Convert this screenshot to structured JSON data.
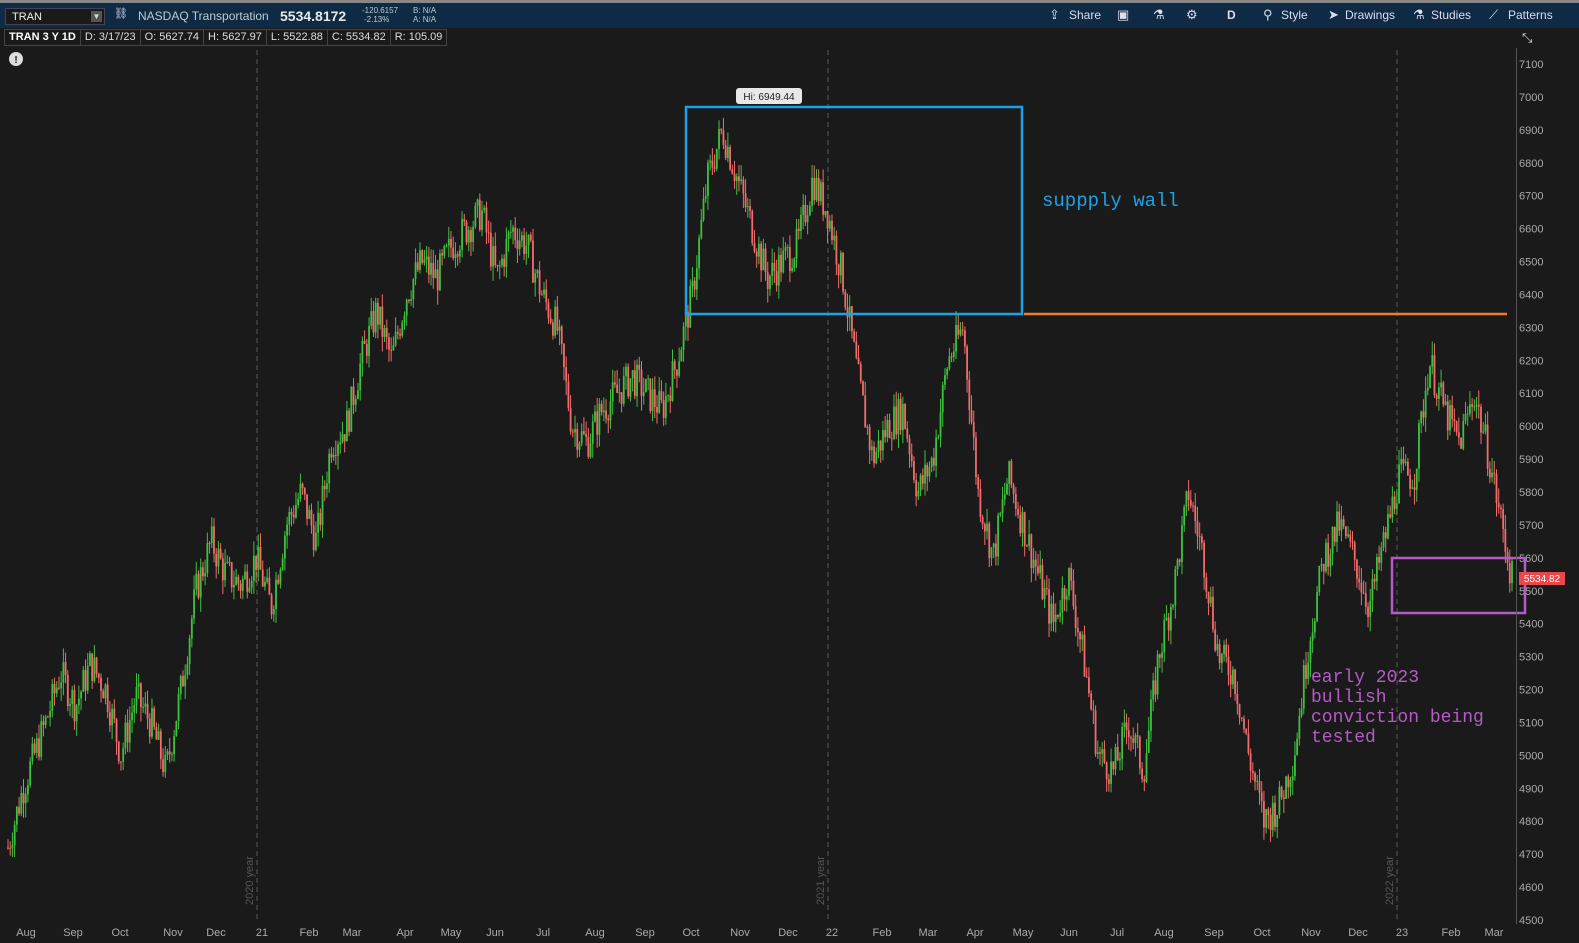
{
  "toolbar": {
    "symbol": "TRAN",
    "name": "NASDAQ Transportation",
    "price": "5534.8172",
    "change": "-120.6157",
    "change_pct": "-2.13%",
    "bid": "B: N/A",
    "ask": "A: N/A",
    "share": "Share",
    "period": "D",
    "style": "Style",
    "drawings": "Drawings",
    "studies": "Studies",
    "patterns": "Patterns"
  },
  "info": {
    "title": "TRAN 3 Y 1D",
    "date": "D: 3/17/23",
    "open": "O: 5627.74",
    "high": "H: 5627.97",
    "low": "L: 5522.88",
    "close": "C: 5534.82",
    "range": "R: 105.09"
  },
  "colors": {
    "up": "#3ec23e",
    "down": "#f36b6b",
    "blue_box": "#1ea0e6",
    "orange_line": "#f07c28",
    "purple": "#b65ac8"
  },
  "chart_data": {
    "type": "candlestick",
    "ylim": [
      4500,
      7150
    ],
    "yticks": [
      7100,
      7000,
      6900,
      6800,
      6700,
      6600,
      6500,
      6400,
      6300,
      6200,
      6100,
      6000,
      5900,
      5800,
      5700,
      5600,
      5500,
      5400,
      5300,
      5200,
      5100,
      5000,
      4900,
      4800,
      4700,
      4600,
      4500
    ],
    "x_labels": [
      "Aug",
      "Sep",
      "Oct",
      "Nov",
      "Dec",
      "21",
      "Feb",
      "Mar",
      "Apr",
      "May",
      "Jun",
      "Jul",
      "Aug",
      "Sep",
      "Oct",
      "Nov",
      "Dec",
      "22",
      "Feb",
      "Mar",
      "Apr",
      "May",
      "Jun",
      "Jul",
      "Aug",
      "Sep",
      "Oct",
      "Nov",
      "Dec",
      "23",
      "Feb",
      "Mar"
    ],
    "year_separators": [
      "2020 year",
      "2021 year",
      "2022 year"
    ],
    "last_price": "5534.82",
    "high_label": "Hi: 6949.44",
    "price_path": [
      [
        0,
        4720
      ],
      [
        0.01,
        4900
      ],
      [
        0.025,
        5100
      ],
      [
        0.035,
        5250
      ],
      [
        0.045,
        5150
      ],
      [
        0.055,
        5280
      ],
      [
        0.065,
        5200
      ],
      [
        0.075,
        5000
      ],
      [
        0.085,
        5180
      ],
      [
        0.095,
        5100
      ],
      [
        0.105,
        4950
      ],
      [
        0.115,
        5200
      ],
      [
        0.125,
        5500
      ],
      [
        0.135,
        5650
      ],
      [
        0.145,
        5550
      ],
      [
        0.155,
        5520
      ],
      [
        0.165,
        5600
      ],
      [
        0.175,
        5450
      ],
      [
        0.185,
        5700
      ],
      [
        0.195,
        5800
      ],
      [
        0.205,
        5650
      ],
      [
        0.215,
        5950
      ],
      [
        0.225,
        6000
      ],
      [
        0.235,
        6200
      ],
      [
        0.245,
        6350
      ],
      [
        0.255,
        6200
      ],
      [
        0.265,
        6400
      ],
      [
        0.275,
        6500
      ],
      [
        0.285,
        6450
      ],
      [
        0.295,
        6550
      ],
      [
        0.305,
        6600
      ],
      [
        0.315,
        6650
      ],
      [
        0.325,
        6450
      ],
      [
        0.335,
        6600
      ],
      [
        0.345,
        6550
      ],
      [
        0.355,
        6400
      ],
      [
        0.365,
        6300
      ],
      [
        0.375,
        6000
      ],
      [
        0.385,
        5950
      ],
      [
        0.395,
        6050
      ],
      [
        0.405,
        6100
      ],
      [
        0.415,
        6150
      ],
      [
        0.425,
        6100
      ],
      [
        0.435,
        6050
      ],
      [
        0.445,
        6200
      ],
      [
        0.455,
        6400
      ],
      [
        0.465,
        6750
      ],
      [
        0.475,
        6900
      ],
      [
        0.485,
        6750
      ],
      [
        0.495,
        6600
      ],
      [
        0.505,
        6450
      ],
      [
        0.515,
        6500
      ],
      [
        0.525,
        6550
      ],
      [
        0.535,
        6750
      ],
      [
        0.545,
        6650
      ],
      [
        0.555,
        6450
      ],
      [
        0.565,
        6150
      ],
      [
        0.575,
        5900
      ],
      [
        0.585,
        6000
      ],
      [
        0.595,
        6050
      ],
      [
        0.605,
        5800
      ],
      [
        0.615,
        5900
      ],
      [
        0.625,
        6200
      ],
      [
        0.635,
        6300
      ],
      [
        0.645,
        5800
      ],
      [
        0.655,
        5600
      ],
      [
        0.665,
        5850
      ],
      [
        0.675,
        5700
      ],
      [
        0.685,
        5550
      ],
      [
        0.695,
        5400
      ],
      [
        0.705,
        5550
      ],
      [
        0.715,
        5300
      ],
      [
        0.725,
        5000
      ],
      [
        0.735,
        4950
      ],
      [
        0.745,
        5100
      ],
      [
        0.755,
        4950
      ],
      [
        0.765,
        5300
      ],
      [
        0.775,
        5500
      ],
      [
        0.785,
        5800
      ],
      [
        0.795,
        5600
      ],
      [
        0.805,
        5300
      ],
      [
        0.815,
        5250
      ],
      [
        0.825,
        5000
      ],
      [
        0.835,
        4800
      ],
      [
        0.845,
        4850
      ],
      [
        0.855,
        5000
      ],
      [
        0.865,
        5350
      ],
      [
        0.875,
        5600
      ],
      [
        0.885,
        5700
      ],
      [
        0.895,
        5600
      ],
      [
        0.905,
        5450
      ],
      [
        0.915,
        5650
      ],
      [
        0.925,
        5850
      ],
      [
        0.935,
        5850
      ],
      [
        0.945,
        6200
      ],
      [
        0.955,
        6050
      ],
      [
        0.965,
        5950
      ],
      [
        0.975,
        6100
      ],
      [
        0.985,
        5900
      ],
      [
        1.0,
        5535
      ]
    ],
    "annotations": {
      "supply_text": "suppply wall",
      "bullish_lines": [
        "early 2023",
        "bullish",
        "conviction being",
        "tested"
      ]
    }
  }
}
